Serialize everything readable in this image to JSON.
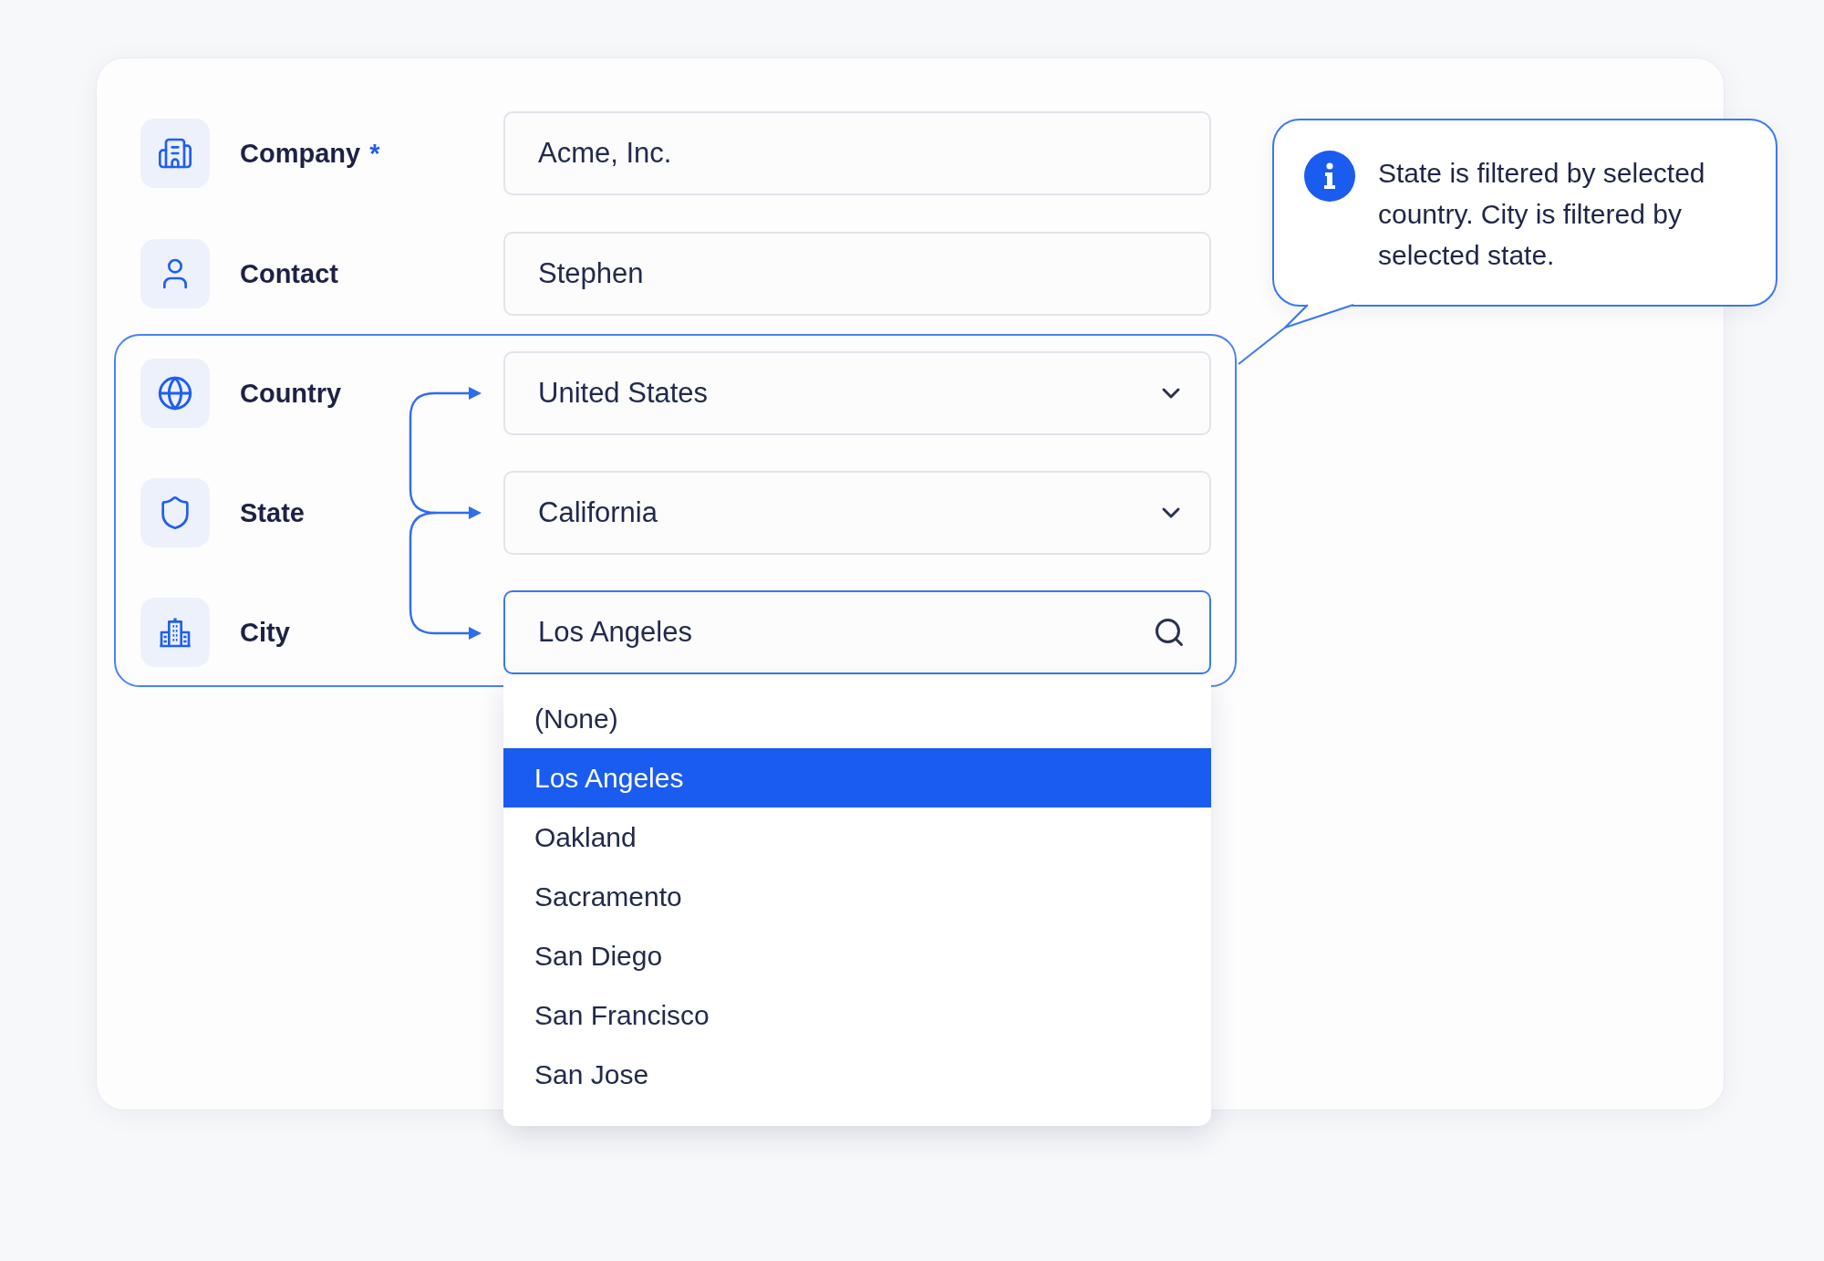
{
  "fields": [
    {
      "label": "Company",
      "required_mark": "*",
      "kind": "text",
      "value": "Acme, Inc.",
      "focused": false
    },
    {
      "label": "Contact",
      "kind": "text",
      "value": "Stephen",
      "focused": false
    }
  ],
  "linked_fields": [
    {
      "label": "Country",
      "kind": "select",
      "value": "United States",
      "focused": false
    },
    {
      "label": "State",
      "kind": "select",
      "value": "California",
      "focused": false
    },
    {
      "label": "City",
      "kind": "search",
      "value": "Los Angeles",
      "focused": true
    }
  ],
  "city_dropdown": {
    "options": [
      {
        "label": "(None)",
        "selected": false
      },
      {
        "label": "Los Angeles",
        "selected": true
      },
      {
        "label": "Oakland",
        "selected": false
      },
      {
        "label": "Sacramento",
        "selected": false
      },
      {
        "label": "San Diego",
        "selected": false
      },
      {
        "label": "San Francisco",
        "selected": false
      },
      {
        "label": "San Jose",
        "selected": false
      }
    ]
  },
  "callout": {
    "text": "State is filtered by selected country. City is filtered by selected state."
  }
}
